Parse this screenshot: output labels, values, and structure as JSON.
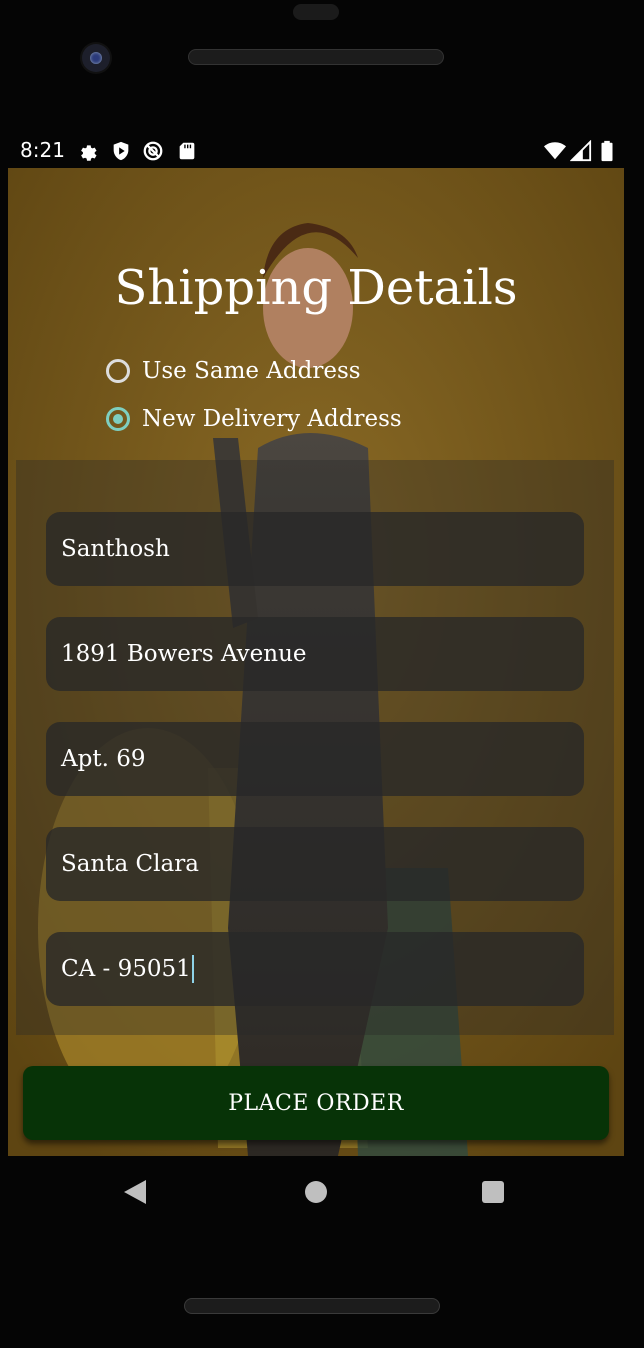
{
  "status_bar": {
    "time": "8:21",
    "left_icons": [
      "gear-icon",
      "shield-play-icon",
      "accessibility-icon",
      "sd-card-icon"
    ],
    "right_icons": [
      "wifi-icon",
      "signal-icon",
      "battery-icon"
    ]
  },
  "page": {
    "title": "Shipping Details",
    "radio_options": [
      {
        "label": "Use Same Address",
        "checked": false
      },
      {
        "label": "New Delivery Address",
        "checked": true
      }
    ],
    "fields": [
      {
        "value": "Santhosh"
      },
      {
        "value": "1891 Bowers Avenue"
      },
      {
        "value": "Apt. 69"
      },
      {
        "value": "Santa Clara"
      },
      {
        "value": "CA - 95051",
        "focused": true
      }
    ],
    "place_order_label": "PLACE ORDER"
  },
  "navbar": {
    "icons": [
      "back-icon",
      "home-icon",
      "recents-icon"
    ]
  },
  "colors": {
    "accent": "#7ecfc0",
    "button": "#073307",
    "background": "#7a5a1a"
  }
}
